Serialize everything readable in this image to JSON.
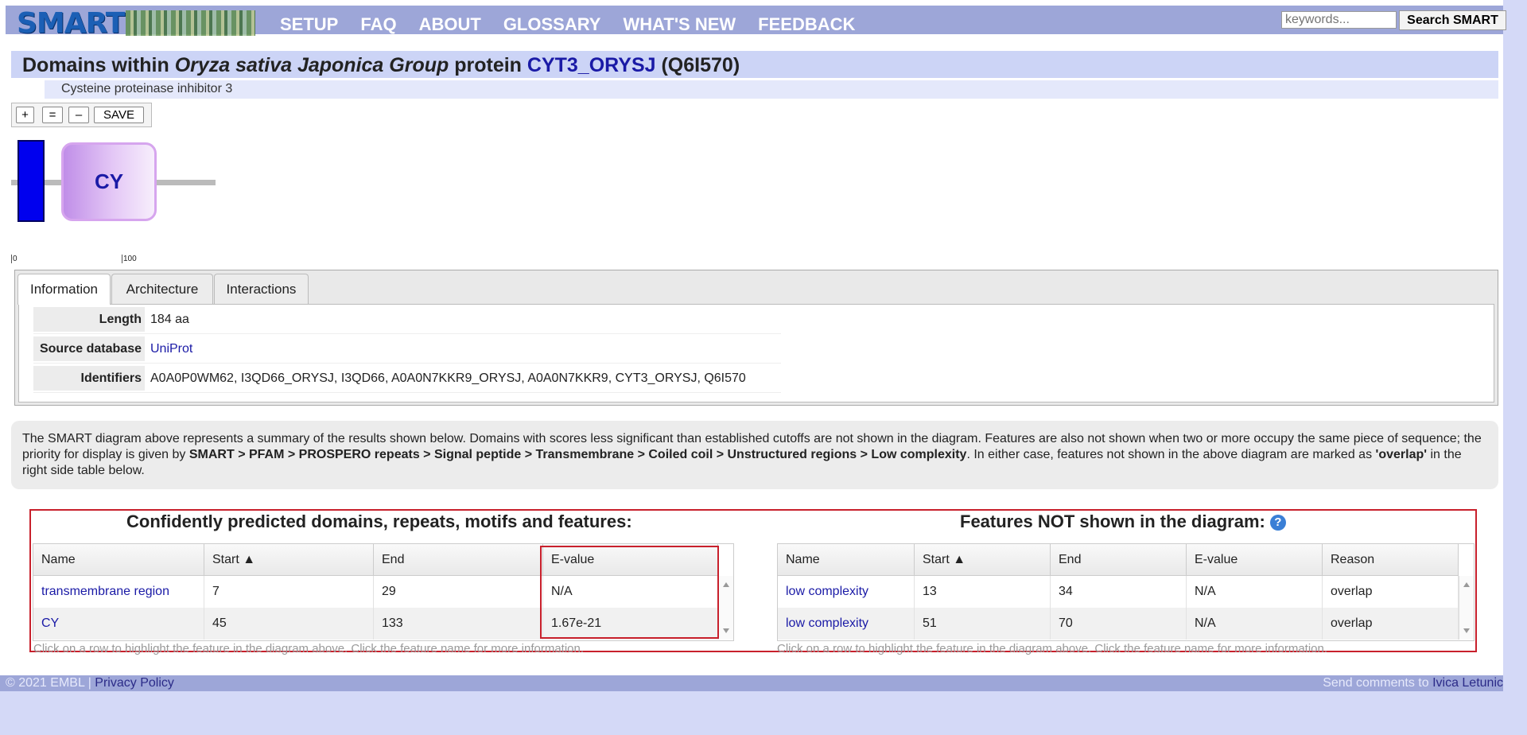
{
  "header": {
    "logo_text": "SMART",
    "nav": [
      "SETUP",
      "FAQ",
      "ABOUT",
      "GLOSSARY",
      "WHAT'S NEW",
      "FEEDBACK"
    ],
    "search_placeholder": "keywords...",
    "search_button": "Search SMART"
  },
  "title": {
    "prefix": "Domains within",
    "organism": "Oryza sativa Japonica Group",
    "mid": "protein",
    "protein_id": "CYT3_ORYSJ",
    "accession": "(Q6I570)",
    "subtitle": "Cysteine proteinase inhibitor 3"
  },
  "zoom": {
    "plus": "+",
    "equal": "=",
    "minus": "–",
    "save": "SAVE"
  },
  "diagram": {
    "domain_label": "CY",
    "ticks": [
      "0",
      "100"
    ],
    "colors": {
      "transmembrane": "#0000ee",
      "cy_domain": "#c08ee8"
    }
  },
  "tabs": [
    "Information",
    "Architecture",
    "Interactions"
  ],
  "info": {
    "length_key": "Length",
    "length_val": "184 aa",
    "source_key": "Source database",
    "source_val": "UniProt",
    "ids_key": "Identifiers",
    "ids_val": "A0A0P0WM62, I3QD66_ORYSJ, I3QD66, A0A0N7KKR9_ORYSJ, A0A0N7KKR9, CYT3_ORYSJ, Q6I570"
  },
  "description": {
    "part1": "The SMART diagram above represents a summary of the results shown below. Domains with scores less significant than established cutoffs are not shown in the diagram. Features are also not shown when two or more occupy the same piece of sequence; the priority for display is given by ",
    "priority": "SMART > PFAM > PROSPERO repeats > Signal peptide > Transmembrane > Coiled coil > Unstructured regions > Low complexity",
    "part2": ". In either case, features not shown in the above diagram are marked as ",
    "overlap": "'overlap'",
    "part3": " in the right side table below."
  },
  "left_table": {
    "heading": "Confidently predicted domains, repeats, motifs and features:",
    "columns": [
      "Name",
      "Start ▲",
      "End",
      "E-value"
    ],
    "rows": [
      [
        "transmembrane region",
        "7",
        "29",
        "N/A"
      ],
      [
        "CY",
        "45",
        "133",
        "1.67e-21"
      ]
    ],
    "hint": "Click on a row to highlight the feature in the diagram above. Click the feature name for more information."
  },
  "right_table": {
    "heading": "Features NOT shown in the diagram:",
    "help_icon": "?",
    "columns": [
      "Name",
      "Start ▲",
      "End",
      "E-value",
      "Reason"
    ],
    "rows": [
      [
        "low complexity",
        "13",
        "34",
        "N/A",
        "overlap"
      ],
      [
        "low complexity",
        "51",
        "70",
        "N/A",
        "overlap"
      ]
    ],
    "hint": "Click on a row to highlight the feature in the diagram above. Click the feature name for more information."
  },
  "footer": {
    "copyright": "© 2021 EMBL | ",
    "privacy": "Privacy Policy",
    "comments": "Send comments to ",
    "contact": "Ivica Letunic"
  }
}
